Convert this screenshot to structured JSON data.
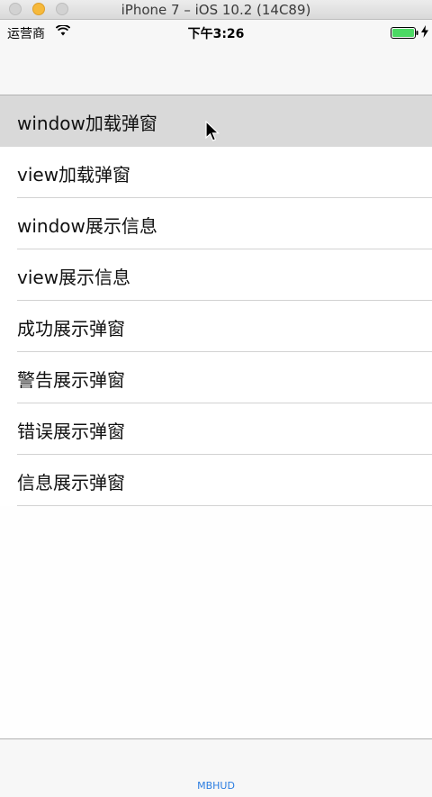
{
  "window": {
    "title": "iPhone 7 – iOS 10.2 (14C89)"
  },
  "status_bar": {
    "carrier": "运营商",
    "time": "下午3:26",
    "battery_color": "#4cd964"
  },
  "table": {
    "cells": [
      {
        "label": "window加载弹窗"
      },
      {
        "label": "view加载弹窗"
      },
      {
        "label": "window展示信息"
      },
      {
        "label": "view展示信息"
      },
      {
        "label": "成功展示弹窗"
      },
      {
        "label": "警告展示弹窗"
      },
      {
        "label": "错误展示弹窗"
      },
      {
        "label": "信息展示弹窗"
      }
    ]
  },
  "tab_bar": {
    "items": [
      {
        "label": "MBHUD",
        "color": "#2b7de1"
      }
    ]
  }
}
